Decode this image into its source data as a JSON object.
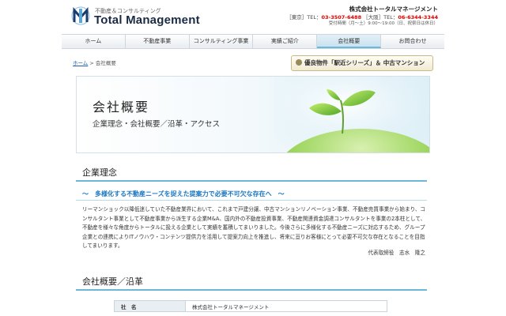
{
  "header": {
    "logo_subtitle": "不動産＆コンサルティング",
    "logo_title": "Total Management",
    "company_name": "株式会社トータルマネージメント",
    "tokyo_label": "［東京］TEL：",
    "tokyo_tel": "03-3507-6488",
    "osaka_label": "［大阪］TEL：",
    "osaka_tel": "06-6344-3344",
    "hours": "受付時間（月〜土）9:00〜19:00（日、祝祭日は休日）"
  },
  "nav": {
    "items": [
      {
        "label": "ホーム"
      },
      {
        "label": "不動産事業"
      },
      {
        "label": "コンサルティング事業"
      },
      {
        "label": "実績ご紹介"
      },
      {
        "label": "会社概要"
      },
      {
        "label": "お問合わせ"
      }
    ],
    "active_index": 4
  },
  "breadcrumb": {
    "home": "ホーム",
    "current": "> 会社概要"
  },
  "banner_ad": {
    "text": "優良物件「駅近シリーズ」＆ 中古マンション"
  },
  "hero": {
    "title": "会社概要",
    "subtitle": "企業理念・会社概要／沿革・アクセス"
  },
  "philosophy": {
    "heading": "企業理念",
    "tagline": "〜　多様化する不動産ニーズを捉えた提案力で必要不可欠な存在へ　〜",
    "body": "リーマンショック以降低迷していた不動産業界において、これまで戸建分譲、中古マンションリノベーション事業、不動産売買事業から始まり、コンサルタント事業として不動産事業から派生する企業M&A、国内外の不動産投資事業、不動産関連資金調達コンサルタントを事業の2本柱として、不動産を様々な角度からトータルに扱える企業として実績を蓄積してまいりました。今後さらに多様化する不動産ニーズに対応するため、グループ企業との連携によりITノウハウ・コンテンツ提供力を活用して提案力向上を推進し、将来に亘りお客様にとって必要不可欠な存在となることを目指してまいります。",
    "signature": "代表取締役　志水　隆之"
  },
  "overview": {
    "heading": "会社概要／沿革",
    "rows": [
      {
        "label": "社　名",
        "value": "株式会社トータルマネージメント"
      }
    ]
  },
  "colors": {
    "accent": "#6cb8d9",
    "tagline": "#1a77c2",
    "tel": "#dd0000"
  }
}
